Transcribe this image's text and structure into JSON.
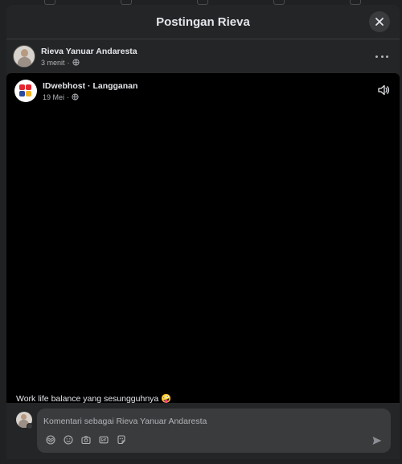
{
  "modal": {
    "title": "Postingan Rieva"
  },
  "sharer": {
    "name": "Rieva Yanuar Andaresta",
    "time": "3 menit",
    "separator": "·",
    "audience_icon": "globe-icon"
  },
  "original_post": {
    "page_name": "IDwebhost",
    "separator": "·",
    "action_label": "Langganan",
    "date": "19 Mei",
    "audience_icon": "globe-icon",
    "caption": "Work life balance yang sesungguhnya 🤪",
    "sound_icon": "speaker-icon"
  },
  "comment": {
    "placeholder": "Komentari sebagai Rieva Yanuar Andaresta",
    "tools": [
      "avatar-sticker-icon",
      "emoji-icon",
      "camera-icon",
      "gif-icon",
      "sticker-icon"
    ],
    "send_icon": "send-icon"
  },
  "colors": {
    "modal_bg": "#242526",
    "video_bg": "#000000",
    "input_bg": "#3a3b3c",
    "primary_text": "#e4e6eb",
    "secondary_text": "#b0b3b8",
    "brand_red": "#e3262f",
    "brand_blue": "#2b4ba0",
    "brand_yellow": "#f4b223"
  }
}
